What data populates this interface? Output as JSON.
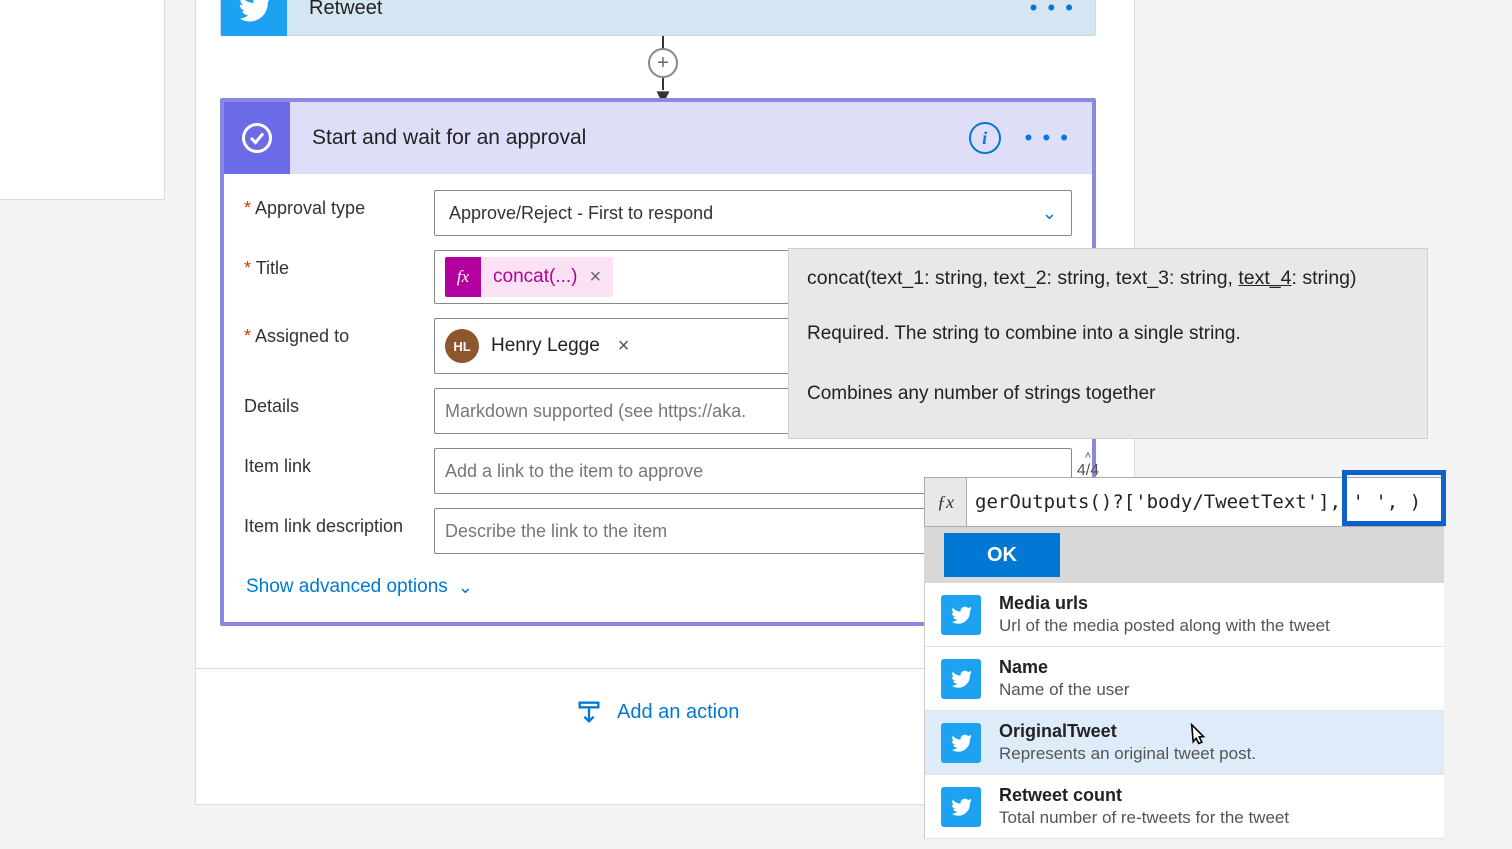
{
  "top_panel_dots": "•  •  •",
  "retweet": {
    "title": "Retweet"
  },
  "approval": {
    "title": "Start and wait for an approval",
    "labels": {
      "approval_type": "Approval type",
      "title": "Title",
      "assigned_to": "Assigned to",
      "details": "Details",
      "item_link": "Item link",
      "item_link_desc": "Item link description"
    },
    "values": {
      "approval_type": "Approve/Reject - First to respond",
      "title_token": "concat(...)",
      "assigned_person": "Henry Legge",
      "assigned_initials": "HL"
    },
    "placeholders": {
      "details": "Markdown supported (see https://aka.",
      "item_link": "Add a link to the item to approve",
      "item_link_desc": "Describe the link to the item"
    },
    "item_link_counter": "4/4",
    "show_advanced": "Show advanced options"
  },
  "add_action": "Add an action",
  "tooltip": {
    "signature_pre": "concat(text_1: string, text_2: string, text_3: string, ",
    "signature_param": "text_4",
    "signature_post": ": string)",
    "desc1": "Required. The string to combine into a single string.",
    "desc2": "Combines any number of strings together"
  },
  "expression": {
    "text": "gerOutputs()?['body/TweetText'], ' ', )",
    "ok": "OK"
  },
  "dynamic": [
    {
      "title": "Media urls",
      "sub": "Url of the media posted along with the tweet"
    },
    {
      "title": "Name",
      "sub": "Name of the user"
    },
    {
      "title": "OriginalTweet",
      "sub": "Represents an original tweet post."
    },
    {
      "title": "Retweet count",
      "sub": "Total number of re-tweets for the tweet"
    }
  ]
}
